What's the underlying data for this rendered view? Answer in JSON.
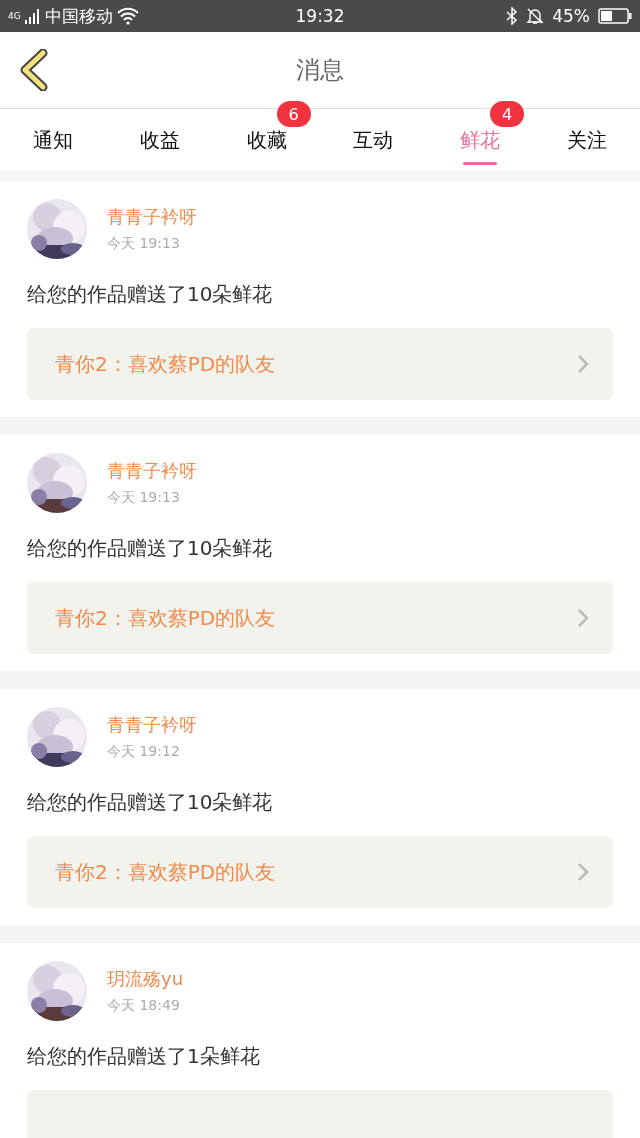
{
  "status_bar": {
    "network": "4G",
    "carrier": "中国移动",
    "time": "19:32",
    "battery_text": "45%"
  },
  "header": {
    "title": "消息"
  },
  "tabs": [
    {
      "label": "通知",
      "selected": false
    },
    {
      "label": "收益",
      "selected": false
    },
    {
      "label": "收藏",
      "selected": false,
      "badge": "6"
    },
    {
      "label": "互动",
      "selected": false
    },
    {
      "label": "鲜花",
      "selected": true,
      "badge": "4"
    },
    {
      "label": "关注",
      "selected": false
    }
  ],
  "messages": [
    {
      "user": "青青子衿呀",
      "time": "今天 19:13",
      "text": "给您的作品赠送了10朵鲜花",
      "work": "青你2：喜欢蔡PD的队友"
    },
    {
      "user": "青青子衿呀",
      "time": "今天 19:13",
      "text": "给您的作品赠送了10朵鲜花",
      "work": "青你2：喜欢蔡PD的队友"
    },
    {
      "user": "青青子衿呀",
      "time": "今天 19:12",
      "text": "给您的作品赠送了10朵鲜花",
      "work": "青你2：喜欢蔡PD的队友"
    },
    {
      "user": "玥流殇yu",
      "time": "今天 18:49",
      "text": "给您的作品赠送了1朵鲜花"
    }
  ]
}
